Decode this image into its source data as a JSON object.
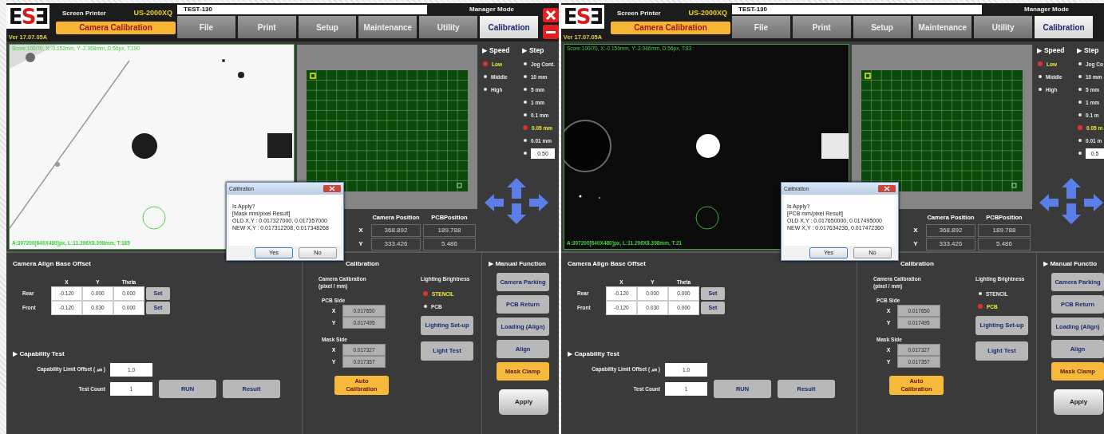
{
  "screens": [
    {
      "header": {
        "logo": [
          "E",
          "S",
          "Ǝ"
        ],
        "version": "Ver 17.07.05A",
        "product": "Screen Printer",
        "model": "US-2000XQ",
        "page_title": "Camera Calibration",
        "job_name": "TEST-130",
        "mode": "Manager Mode",
        "tabs": [
          {
            "label": "File",
            "selected": false
          },
          {
            "label": "Print",
            "selected": false
          },
          {
            "label": "Setup",
            "selected": false
          },
          {
            "label": "Maintenance",
            "selected": false
          },
          {
            "label": "Utility",
            "selected": false
          },
          {
            "label": "Calibration",
            "selected": true
          }
        ],
        "window_controls": [
          {
            "kind": "close"
          },
          {
            "kind": "minimize"
          }
        ]
      },
      "camera": {
        "kind": "picture",
        "top_text": "Score:100/70, X:-0.152mm, Y:-2.968mm, D:56px, T:190",
        "bottom_text": "A:307200[640X480]px, L:11.296X8.398mm, T:185"
      },
      "speed": {
        "title": "▶ Speed",
        "options": [
          {
            "label": "Low",
            "selected": true
          },
          {
            "label": "Middle",
            "selected": false
          },
          {
            "label": "High",
            "selected": false
          }
        ]
      },
      "step": {
        "title": "▶ Step",
        "options": [
          {
            "kind": "radio",
            "label": "Jog Cont.",
            "selected": false
          },
          {
            "kind": "radio",
            "label": "10 mm",
            "selected": false
          },
          {
            "kind": "radio",
            "label": "5 mm",
            "selected": false
          },
          {
            "kind": "radio",
            "label": "1 mm",
            "selected": false
          },
          {
            "kind": "radio",
            "label": "0.1 mm",
            "selected": false
          },
          {
            "kind": "radio",
            "label": "0.05 mm",
            "selected": true
          },
          {
            "kind": "radio",
            "label": "0.01 mm",
            "selected": false
          },
          {
            "kind": "input",
            "value": "0.50",
            "selected": false
          }
        ]
      },
      "position": {
        "columns": [
          "Camera Position",
          "PCBPosition"
        ],
        "rows": [
          {
            "axis": "X",
            "values": [
              "368.892",
              "189.788"
            ]
          },
          {
            "axis": "Y",
            "values": [
              "333.426",
              "5.486"
            ]
          }
        ]
      },
      "align_offset": {
        "title": "Camera Align Base Offset",
        "columns": [
          "X",
          "Y",
          "Theta"
        ],
        "rows": [
          {
            "label": "Rear",
            "values": [
              "-0.120",
              "0.000",
              "0.000"
            ],
            "button": "Set"
          },
          {
            "label": "Front",
            "values": [
              "-0.120",
              "0.030",
              "0.000"
            ],
            "button": "Set"
          }
        ]
      },
      "capability": {
        "title": "▶ Capability Test",
        "fields": [
          {
            "label": "Capability Limit Offset ( ㎛ )",
            "value": "1.0"
          },
          {
            "label": "Test Count",
            "value": "1"
          }
        ],
        "buttons": [
          "RUN",
          "Result"
        ]
      },
      "calibration": {
        "title": "Calibration",
        "caption": [
          "Camera Calibration",
          "(pixel / mm)"
        ],
        "groups": [
          {
            "title": "PCB Side",
            "rows": [
              {
                "axis": "X",
                "value": "0.017650"
              },
              {
                "axis": "Y",
                "value": "0.017495"
              }
            ]
          },
          {
            "title": "Mask Side",
            "rows": [
              {
                "axis": "X",
                "value": "0.017327"
              },
              {
                "axis": "Y",
                "value": "0.017357"
              }
            ]
          }
        ],
        "button": {
          "label": "Auto Calibration",
          "active": true
        }
      },
      "lighting": {
        "title": "Lighting Brightness",
        "options": [
          {
            "label": "STENCIL",
            "selected": true
          },
          {
            "label": "PCB",
            "selected": false
          }
        ],
        "buttons": [
          "Lighting Set-up",
          "Light Test"
        ]
      },
      "manual": {
        "title": "▶ Manual Function",
        "buttons": [
          {
            "label": "Camera Parking",
            "active": false
          },
          {
            "label": "PCB Return",
            "active": false
          },
          {
            "label": "Loading (Align)",
            "active": false
          },
          {
            "label": "Align",
            "active": false
          },
          {
            "label": "Mask Clamp",
            "active": true
          }
        ],
        "apply": "Apply"
      },
      "dialog": {
        "title": "Calibration",
        "lines": [
          "Is Apply?",
          "[Mask mm/pixel Result]",
          "OLD X,Y : 0.017327000, 0.017357000",
          "NEW X,Y : 0.017312208, 0.017348268"
        ],
        "buttons": [
          {
            "label": "Yes",
            "focused": true
          },
          {
            "label": "No",
            "focused": false
          }
        ]
      }
    },
    {
      "header": {
        "logo": [
          "E",
          "S",
          "Ǝ"
        ],
        "version": "Ver 17.07.05A",
        "product": "Screen Printer",
        "model": "US-2000XQ",
        "page_title": "Camera Calibration",
        "job_name": "TEST-130",
        "mode": "Manager Mode",
        "tabs": [
          {
            "label": "File",
            "selected": false
          },
          {
            "label": "Print",
            "selected": false
          },
          {
            "label": "Setup",
            "selected": false
          },
          {
            "label": "Maintenance",
            "selected": false
          },
          {
            "label": "Utility",
            "selected": false
          },
          {
            "label": "Calibration",
            "selected": true
          }
        ]
      },
      "camera": {
        "kind": "picture",
        "top_text": "Score:100/70, X:-0.159mm, Y:-2.946mm, D:56px, T:83",
        "bottom_text": "A:307200[640X480]px, L:11.296X8.398mm, T:21"
      },
      "speed": {
        "title": "▶ Speed",
        "options": [
          {
            "label": "Low",
            "selected": true
          },
          {
            "label": "Middle",
            "selected": false
          },
          {
            "label": "High",
            "selected": false
          }
        ]
      },
      "step": {
        "title": "▶ Step",
        "options": [
          {
            "kind": "radio",
            "label": "Jog Co",
            "selected": false
          },
          {
            "kind": "radio",
            "label": "10 mm",
            "selected": false
          },
          {
            "kind": "radio",
            "label": "5 mm",
            "selected": false
          },
          {
            "kind": "radio",
            "label": "1 mm",
            "selected": false
          },
          {
            "kind": "radio",
            "label": "0.1 m",
            "selected": false
          },
          {
            "kind": "radio",
            "label": "0.05 m",
            "selected": true
          },
          {
            "kind": "radio",
            "label": "0.01 m",
            "selected": false
          },
          {
            "kind": "input",
            "value": "0.5",
            "selected": false
          }
        ]
      },
      "position": {
        "columns": [
          "Camera Position",
          "PCBPosition"
        ],
        "rows": [
          {
            "axis": "X",
            "values": [
              "368.892",
              "189.788"
            ]
          },
          {
            "axis": "Y",
            "values": [
              "333.426",
              "5.486"
            ]
          }
        ]
      },
      "align_offset": {
        "title": "Camera Align Base Offset",
        "columns": [
          "X",
          "Y",
          "Theta"
        ],
        "rows": [
          {
            "label": "Rear",
            "values": [
              "-0.120",
              "0.000",
              "0.000"
            ],
            "button": "Set"
          },
          {
            "label": "Front",
            "values": [
              "-0.120",
              "0.030",
              "0.000"
            ],
            "button": "Set"
          }
        ]
      },
      "capability": {
        "title": "▶ Capability Test",
        "fields": [
          {
            "label": "Capability Limit Offset ( ㎛ )",
            "value": "1.0"
          },
          {
            "label": "Test Count",
            "value": "1"
          }
        ],
        "buttons": [
          "RUN",
          "Result"
        ]
      },
      "calibration": {
        "title": "Calibration",
        "caption": [
          "Camera Calibration",
          "(pixel / mm)"
        ],
        "groups": [
          {
            "title": "PCB Side",
            "rows": [
              {
                "axis": "X",
                "value": "0.017650"
              },
              {
                "axis": "Y",
                "value": "0.017495"
              }
            ]
          },
          {
            "title": "Mask Side",
            "rows": [
              {
                "axis": "X",
                "value": "0.017327"
              },
              {
                "axis": "Y",
                "value": "0.017357"
              }
            ]
          }
        ],
        "button": {
          "label": "Auto Calibration",
          "active": true
        }
      },
      "lighting": {
        "title": "Lighting Brightness",
        "options": [
          {
            "label": "STENCIL",
            "selected": false
          },
          {
            "label": "PCB",
            "selected": true
          }
        ],
        "buttons": [
          "Lighting Set-up",
          "Light Test"
        ]
      },
      "manual": {
        "title": "▶ Manual Functio",
        "buttons": [
          {
            "label": "Camera Parking",
            "active": false
          },
          {
            "label": "PCB Return",
            "active": false
          },
          {
            "label": "Loading (Align)",
            "active": false
          },
          {
            "label": "Align",
            "active": false
          },
          {
            "label": "Mask Clamp",
            "active": true
          }
        ],
        "apply": "Apply"
      },
      "dialog": {
        "title": "Calibration",
        "lines": [
          "Is Apply?",
          "[PCB mm/pixel Result]",
          "OLD X,Y : 0.017650000, 0.017495000",
          "NEW X,Y : 0.017634236, 0.017472360"
        ],
        "buttons": [
          {
            "label": "Yes",
            "focused": true
          },
          {
            "label": "No",
            "focused": false
          }
        ]
      }
    }
  ]
}
